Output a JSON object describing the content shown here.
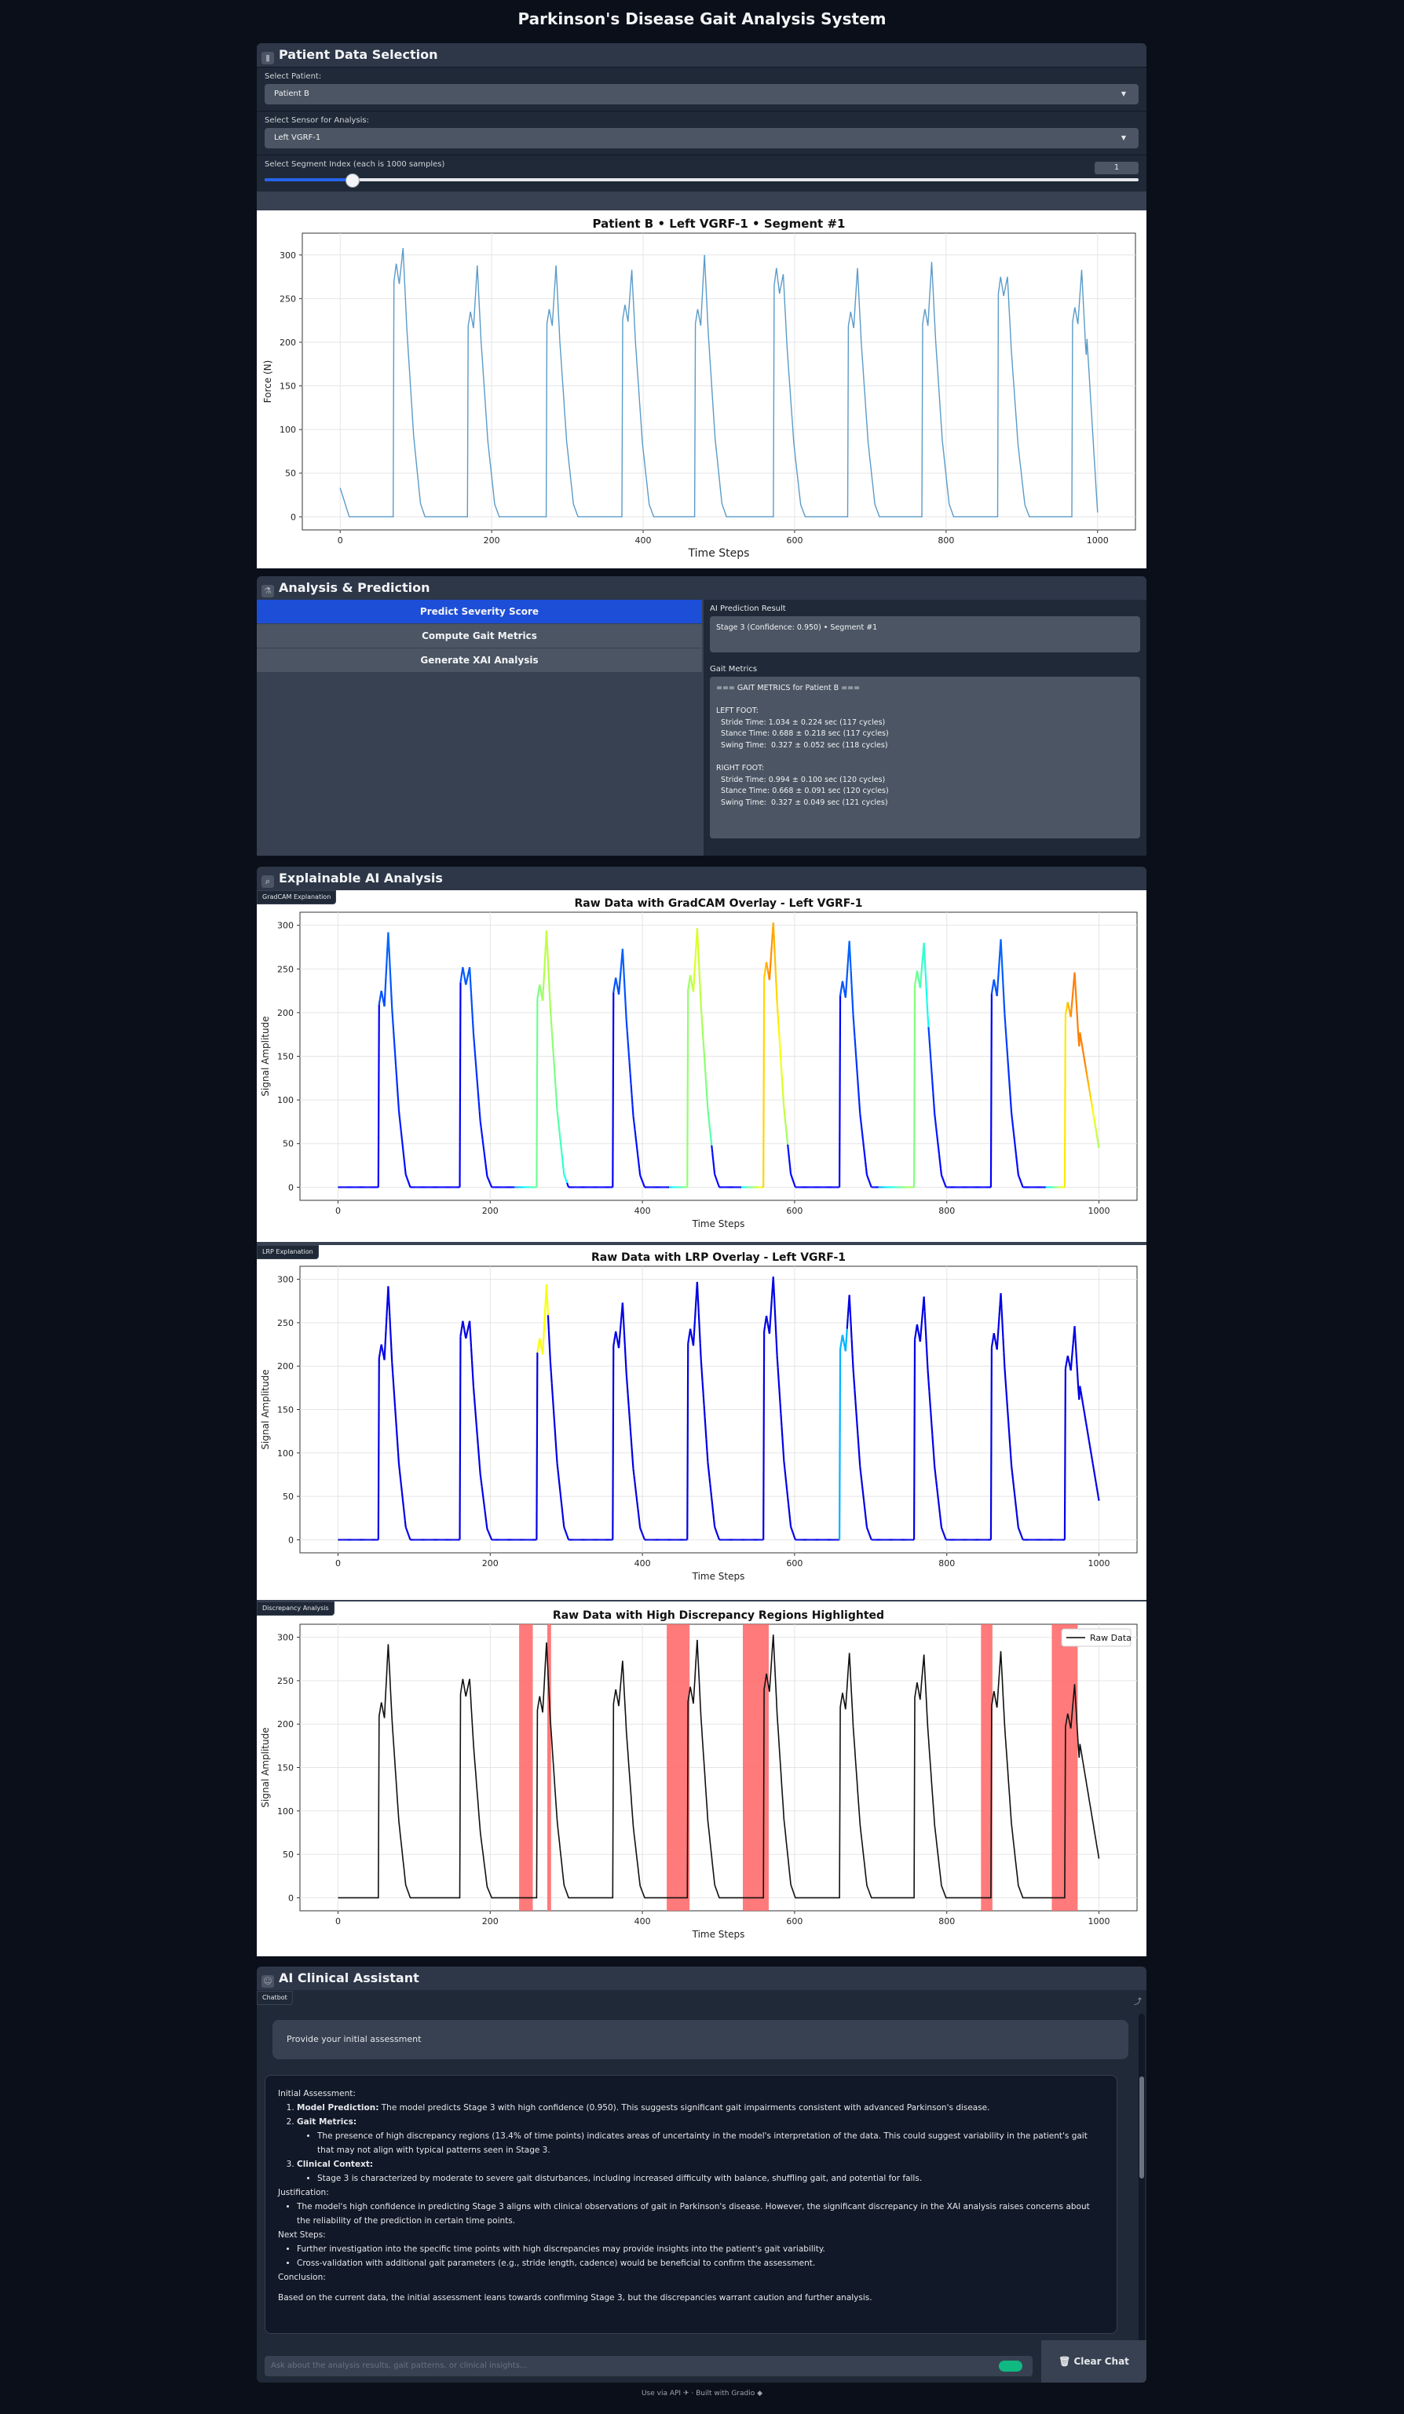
{
  "title": "Parkinson's Disease Gait Analysis System",
  "colors": {
    "primary": "#1d4ed8",
    "panel": "#374151",
    "background": "#0b0f19"
  },
  "patient_section": {
    "header": "Patient Data Selection",
    "header_icon": "bar-chart-icon",
    "patient_label": "Select Patient:",
    "patient_value": "Patient B",
    "sensor_label": "Select Sensor for Analysis:",
    "sensor_value": "Left VGRF-1",
    "segment_label": "Select Segment Index (each is 1000 samples)",
    "segment_value": "1",
    "segment_fraction": 0.1
  },
  "chart_data": [
    {
      "type": "line",
      "title": "Patient B • Left VGRF-1 • Segment #1",
      "xlabel": "Time Steps",
      "ylabel": "Force (N)",
      "xlim": [
        -50,
        1050
      ],
      "ylim": [
        -15,
        325
      ],
      "xticks": [
        0,
        200,
        400,
        600,
        800,
        1000
      ],
      "yticks": [
        0,
        50,
        100,
        150,
        200,
        250,
        300
      ],
      "grid": true,
      "peaks": [
        {
          "onset": 70,
          "p1": 290,
          "p2": 308
        },
        {
          "onset": 168,
          "p1": 235,
          "p2": 288
        },
        {
          "onset": 272,
          "p1": 238,
          "p2": 288
        },
        {
          "onset": 372,
          "p1": 243,
          "p2": 283
        },
        {
          "onset": 468,
          "p1": 238,
          "p2": 300
        },
        {
          "onset": 572,
          "p1": 285,
          "p2": 278
        },
        {
          "onset": 670,
          "p1": 235,
          "p2": 285
        },
        {
          "onset": 768,
          "p1": 238,
          "p2": 292
        },
        {
          "onset": 868,
          "p1": 275,
          "p2": 275
        },
        {
          "onset": 966,
          "p1": 240,
          "p2": 283
        }
      ],
      "start_value": 33,
      "end_value": 5
    },
    {
      "type": "line",
      "title": "Raw Data with GradCAM Overlay - Left VGRF-1",
      "xlabel": "Time Steps",
      "ylabel": "Signal Amplitude",
      "xlim": [
        -50,
        1050
      ],
      "ylim": [
        -15,
        315
      ],
      "xticks": [
        0,
        200,
        400,
        600,
        800,
        1000
      ],
      "yticks": [
        0,
        50,
        100,
        150,
        200,
        250,
        300
      ],
      "grid": true,
      "peaks": [
        {
          "onset": 53,
          "p1": 225,
          "p2": 292
        },
        {
          "onset": 160,
          "p1": 252,
          "p2": 252
        },
        {
          "onset": 261,
          "p1": 232,
          "p2": 294
        },
        {
          "onset": 361,
          "p1": 240,
          "p2": 273
        },
        {
          "onset": 459,
          "p1": 243,
          "p2": 297
        },
        {
          "onset": 559,
          "p1": 258,
          "p2": 303
        },
        {
          "onset": 659,
          "p1": 236,
          "p2": 282
        },
        {
          "onset": 757,
          "p1": 248,
          "p2": 280
        },
        {
          "onset": 858,
          "p1": 238,
          "p2": 284
        },
        {
          "onset": 955,
          "p1": 212,
          "p2": 246
        }
      ],
      "end_value": 45
    },
    {
      "type": "line",
      "title": "Raw Data with LRP Overlay - Left VGRF-1",
      "xlabel": "Time Steps",
      "ylabel": "Signal Amplitude",
      "xlim": [
        -50,
        1050
      ],
      "ylim": [
        -15,
        315
      ],
      "xticks": [
        0,
        200,
        400,
        600,
        800,
        1000
      ],
      "yticks": [
        0,
        50,
        100,
        150,
        200,
        250,
        300
      ],
      "grid": true,
      "peaks": [
        {
          "onset": 53,
          "p1": 225,
          "p2": 292
        },
        {
          "onset": 160,
          "p1": 252,
          "p2": 252
        },
        {
          "onset": 261,
          "p1": 232,
          "p2": 294
        },
        {
          "onset": 361,
          "p1": 240,
          "p2": 273
        },
        {
          "onset": 459,
          "p1": 243,
          "p2": 297
        },
        {
          "onset": 559,
          "p1": 258,
          "p2": 303
        },
        {
          "onset": 659,
          "p1": 236,
          "p2": 282
        },
        {
          "onset": 757,
          "p1": 248,
          "p2": 280
        },
        {
          "onset": 858,
          "p1": 238,
          "p2": 284
        },
        {
          "onset": 955,
          "p1": 212,
          "p2": 246
        }
      ],
      "end_value": 45
    },
    {
      "type": "line",
      "title": "Raw Data with High Discrepancy Regions Highlighted",
      "xlabel": "Time Steps",
      "ylabel": "Signal Amplitude",
      "xlim": [
        -50,
        1050
      ],
      "ylim": [
        -15,
        315
      ],
      "xticks": [
        0,
        200,
        400,
        600,
        800,
        1000
      ],
      "yticks": [
        0,
        50,
        100,
        150,
        200,
        250,
        300
      ],
      "grid": true,
      "legend": [
        "Raw Data"
      ],
      "legend_position": "top-right",
      "highlight_color": "#ff6b6b",
      "regions": [
        [
          238,
          256
        ],
        [
          275,
          280
        ],
        [
          432,
          462
        ],
        [
          532,
          566
        ],
        [
          845,
          860
        ],
        [
          938,
          972
        ]
      ],
      "peaks": [
        {
          "onset": 53,
          "p1": 225,
          "p2": 292
        },
        {
          "onset": 160,
          "p1": 252,
          "p2": 252
        },
        {
          "onset": 261,
          "p1": 232,
          "p2": 294
        },
        {
          "onset": 361,
          "p1": 240,
          "p2": 273
        },
        {
          "onset": 459,
          "p1": 243,
          "p2": 297
        },
        {
          "onset": 559,
          "p1": 258,
          "p2": 303
        },
        {
          "onset": 659,
          "p1": 236,
          "p2": 282
        },
        {
          "onset": 757,
          "p1": 248,
          "p2": 280
        },
        {
          "onset": 858,
          "p1": 238,
          "p2": 284
        },
        {
          "onset": 955,
          "p1": 212,
          "p2": 246
        }
      ],
      "end_value": 45
    }
  ],
  "analysis_section": {
    "header": "Analysis & Prediction",
    "header_icon": "microscope-icon",
    "buttons": [
      "Predict Severity Score",
      "Compute Gait Metrics",
      "Generate XAI Analysis"
    ],
    "prediction_label": "AI Prediction Result",
    "prediction_value": "Stage 3 (Confidence: 0.950) • Segment #1",
    "metrics_label": "Gait Metrics",
    "metrics_value": "=== GAIT METRICS for Patient B ===\n\nLEFT FOOT:\n  Stride Time: 1.034 ± 0.224 sec (117 cycles)\n  Stance Time: 0.688 ± 0.218 sec (117 cycles)\n  Swing Time:  0.327 ± 0.052 sec (118 cycles)\n\nRIGHT FOOT:\n  Stride Time: 0.994 ± 0.100 sec (120 cycles)\n  Stance Time: 0.668 ± 0.091 sec (120 cycles)\n  Swing Time:  0.327 ± 0.049 sec (121 cycles)"
  },
  "xai_section": {
    "header": "Explainable AI Analysis",
    "header_icon": "magnifier-icon",
    "gradcam_label": "GradCAM Explanation",
    "lrp_label": "LRP Explanation",
    "discrepancy_label": "Discrepancy Analysis"
  },
  "assistant_section": {
    "header": "AI Clinical Assistant",
    "header_icon": "robot-icon",
    "chatbot_label": "Chatbot",
    "user_message": "Provide your initial assessment",
    "bot": {
      "intro": "Initial Assessment:",
      "item1_bold": "Model Prediction:",
      "item1_text": " The model predicts Stage 3 with high confidence (0.950). This suggests significant gait impairments consistent with advanced Parkinson's disease.",
      "item2_bold": "Gait Metrics:",
      "item2_sub": "The presence of high discrepancy regions (13.4% of time points) indicates areas of uncertainty in the model's interpretation of the data. This could suggest variability in the patient's gait that may not align with typical patterns seen in Stage 3.",
      "item3_bold": "Clinical Context:",
      "item3_sub": "Stage 3 is characterized by moderate to severe gait disturbances, including increased difficulty with balance, shuffling gait, and potential for falls.",
      "justification_label": "Justification:",
      "justification_text": "The model's high confidence in predicting Stage 3 aligns with clinical observations of gait in Parkinson's disease. However, the significant discrepancy in the XAI analysis raises concerns about the reliability of the prediction in certain time points.",
      "next_label": "Next Steps:",
      "next1": "Further investigation into the specific time points with high discrepancies may provide insights into the patient's gait variability.",
      "next2": "Cross-validation with additional gait parameters (e.g., stride length, cadence) would be beneficial to confirm the assessment.",
      "conclusion_label": "Conclusion:",
      "conclusion_text": "Based on the current data, the initial assessment leans towards confirming Stage 3, but the discrepancies warrant caution and further analysis."
    },
    "input_placeholder": "Ask about the analysis results, gait patterns, or clinical insights...",
    "clear_label": "Clear Chat"
  },
  "footer": {
    "api": "Use via API",
    "built": "Built with Gradio"
  }
}
